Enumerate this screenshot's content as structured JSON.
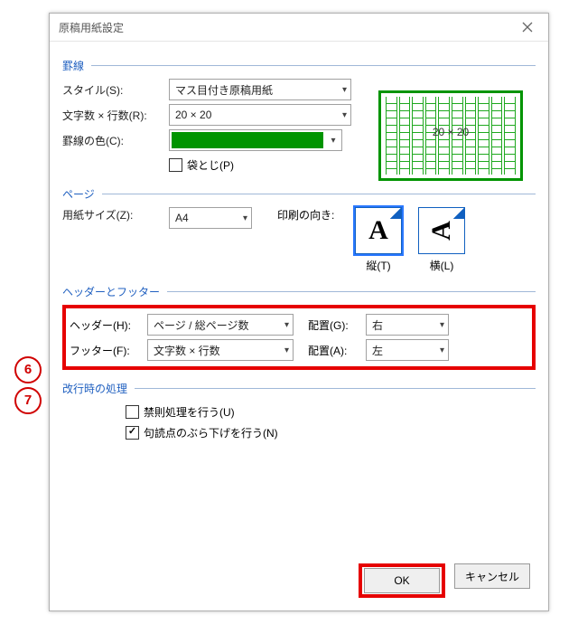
{
  "callouts": {
    "six": "6",
    "seven": "7"
  },
  "dialog": {
    "title": "原稿用紙設定"
  },
  "group": {
    "ruled": "罫線",
    "page": "ページ",
    "hf": "ヘッダーとフッター",
    "wrap": "改行時の処理"
  },
  "ruled": {
    "style_label": "スタイル(S):",
    "style_value": "マス目付き原稿用紙",
    "grid_label": "文字数 × 行数(R):",
    "grid_value": "20 × 20",
    "color_label": "罫線の色(C):",
    "color_hex": "#009400",
    "gutter_label": "袋とじ(P)",
    "preview_label": "20 × 20"
  },
  "page": {
    "size_label": "用紙サイズ(Z):",
    "size_value": "A4",
    "orient_label": "印刷の向き:",
    "portrait": "縦(T)",
    "landscape": "横(L)"
  },
  "hf": {
    "header_label": "ヘッダー(H):",
    "header_value": "ページ / 総ページ数",
    "header_align_label": "配置(G):",
    "header_align_value": "右",
    "footer_label": "フッター(F):",
    "footer_value": "文字数 × 行数",
    "footer_align_label": "配置(A):",
    "footer_align_value": "左"
  },
  "wrap": {
    "kinsoku": "禁則処理を行う(U)",
    "hang": "句読点のぶら下げを行う(N)"
  },
  "buttons": {
    "ok": "OK",
    "cancel": "キャンセル"
  }
}
